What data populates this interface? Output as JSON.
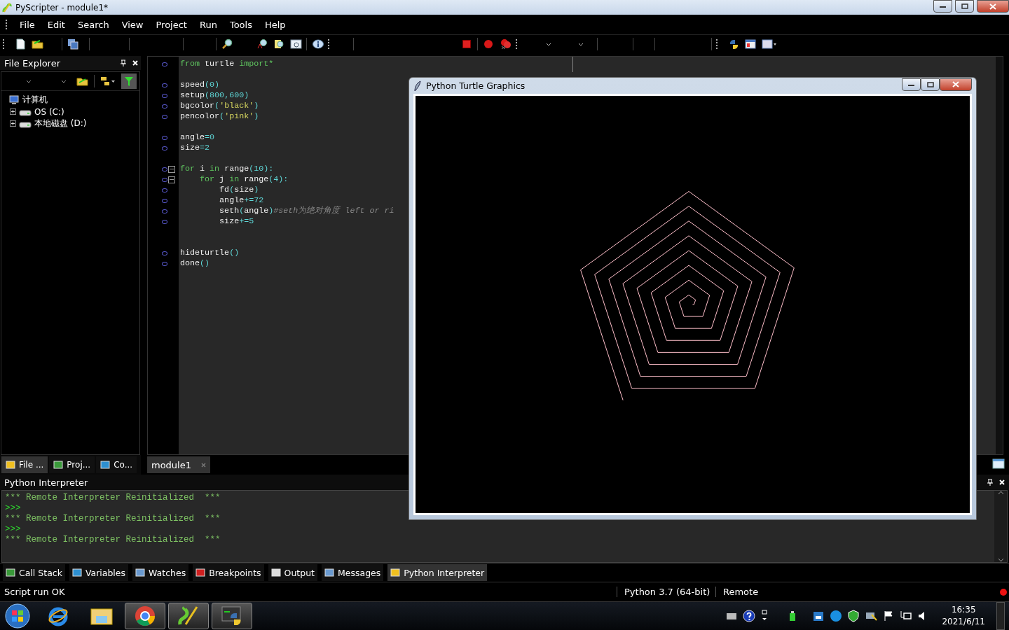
{
  "window": {
    "title": "PyScripter - module1*"
  },
  "menu": [
    "File",
    "Edit",
    "Search",
    "View",
    "Project",
    "Run",
    "Tools",
    "Help"
  ],
  "file_explorer": {
    "title": "File Explorer",
    "tree": [
      {
        "label": "计算机",
        "children": [
          {
            "label": "OS (C:)",
            "expanded": false
          },
          {
            "label": "本地磁盘 (D:)",
            "expanded": false
          }
        ]
      }
    ],
    "tabs": [
      {
        "label": "File ...",
        "selected": true
      },
      {
        "label": "Proj...",
        "selected": false
      },
      {
        "label": "Co...",
        "selected": false
      }
    ]
  },
  "editor": {
    "tabs": [
      {
        "label": "module1",
        "selected": true
      }
    ],
    "lines": [
      {
        "kind": "code",
        "fold": false,
        "tokens": [
          {
            "text": "from",
            "kind": "keyword"
          },
          {
            "text": " turtle ",
            "kind": "name"
          },
          {
            "text": "import*",
            "kind": "keyword"
          }
        ]
      },
      {
        "kind": "blank"
      },
      {
        "kind": "code",
        "fold": false,
        "tokens": [
          {
            "text": "speed",
            "kind": "name"
          },
          {
            "text": "(0)",
            "kind": "number"
          }
        ]
      },
      {
        "kind": "code",
        "fold": false,
        "tokens": [
          {
            "text": "setup",
            "kind": "name"
          },
          {
            "text": "(800,600)",
            "kind": "number"
          }
        ]
      },
      {
        "kind": "code",
        "fold": false,
        "tokens": [
          {
            "text": "bgcolor",
            "kind": "name"
          },
          {
            "text": "(",
            "kind": "number"
          },
          {
            "text": "'black'",
            "kind": "string"
          },
          {
            "text": ")",
            "kind": "number"
          }
        ]
      },
      {
        "kind": "code",
        "fold": false,
        "tokens": [
          {
            "text": "pencolor",
            "kind": "name"
          },
          {
            "text": "(",
            "kind": "number"
          },
          {
            "text": "'pink'",
            "kind": "string"
          },
          {
            "text": ")",
            "kind": "number"
          }
        ]
      },
      {
        "kind": "blank"
      },
      {
        "kind": "code",
        "fold": false,
        "tokens": [
          {
            "text": "angle",
            "kind": "name"
          },
          {
            "text": "=0",
            "kind": "number"
          }
        ]
      },
      {
        "kind": "code",
        "fold": false,
        "tokens": [
          {
            "text": "size",
            "kind": "name"
          },
          {
            "text": "=2",
            "kind": "number"
          }
        ]
      },
      {
        "kind": "blank"
      },
      {
        "kind": "code",
        "fold": true,
        "tokens": [
          {
            "text": "for",
            "kind": "keyword"
          },
          {
            "text": " i ",
            "kind": "name"
          },
          {
            "text": "in",
            "kind": "keyword"
          },
          {
            "text": " range",
            "kind": "name"
          },
          {
            "text": "(10):",
            "kind": "number"
          }
        ]
      },
      {
        "kind": "code",
        "fold": true,
        "tokens": [
          {
            "text": "    for",
            "kind": "keyword"
          },
          {
            "text": " j ",
            "kind": "name"
          },
          {
            "text": "in",
            "kind": "keyword"
          },
          {
            "text": " range",
            "kind": "name"
          },
          {
            "text": "(4):",
            "kind": "number"
          }
        ]
      },
      {
        "kind": "code",
        "fold": false,
        "tokens": [
          {
            "text": "        fd",
            "kind": "name"
          },
          {
            "text": "(",
            "kind": "number"
          },
          {
            "text": "size",
            "kind": "name"
          },
          {
            "text": ")",
            "kind": "number"
          }
        ]
      },
      {
        "kind": "code",
        "fold": false,
        "tokens": [
          {
            "text": "        angle",
            "kind": "name"
          },
          {
            "text": "+=72",
            "kind": "number"
          }
        ]
      },
      {
        "kind": "code",
        "fold": false,
        "tokens": [
          {
            "text": "        seth",
            "kind": "name"
          },
          {
            "text": "(",
            "kind": "number"
          },
          {
            "text": "angle",
            "kind": "name"
          },
          {
            "text": ")",
            "kind": "number"
          },
          {
            "text": "#seth为绝对角度 left or ri",
            "kind": "comment"
          }
        ]
      },
      {
        "kind": "code",
        "fold": false,
        "tokens": [
          {
            "text": "        size",
            "kind": "name"
          },
          {
            "text": "+=5",
            "kind": "number"
          }
        ]
      },
      {
        "kind": "blank"
      },
      {
        "kind": "blank"
      },
      {
        "kind": "code",
        "fold": false,
        "tokens": [
          {
            "text": "hideturtle",
            "kind": "name"
          },
          {
            "text": "()",
            "kind": "number"
          }
        ]
      },
      {
        "kind": "code",
        "fold": false,
        "tokens": [
          {
            "text": "done",
            "kind": "name"
          },
          {
            "text": "()",
            "kind": "number"
          }
        ]
      }
    ]
  },
  "turtle_window": {
    "title": "Python Turtle Graphics"
  },
  "interpreter": {
    "title": "Python Interpreter",
    "lines": [
      {
        "kind": "message",
        "text": "*** Remote Interpreter Reinitialized  ***"
      },
      {
        "kind": "prompt",
        "text": ">>>"
      },
      {
        "kind": "message",
        "text": "*** Remote Interpreter Reinitialized  ***"
      },
      {
        "kind": "prompt",
        "text": ">>>"
      },
      {
        "kind": "message",
        "text": "*** Remote Interpreter Reinitialized  ***"
      }
    ]
  },
  "bottom_tabs": [
    {
      "label": "Call Stack",
      "selected": false
    },
    {
      "label": "Variables",
      "selected": false
    },
    {
      "label": "Watches",
      "selected": false
    },
    {
      "label": "Breakpoints",
      "selected": false
    },
    {
      "label": "Output",
      "selected": false
    },
    {
      "label": "Messages",
      "selected": false
    },
    {
      "label": "Python Interpreter",
      "selected": true
    }
  ],
  "status_bar": {
    "message": "Script run OK",
    "engine": "Python 3.7 (64-bit)",
    "mode": "Remote"
  },
  "taskbar": {
    "time": "16:35",
    "date": "2021/6/11"
  }
}
